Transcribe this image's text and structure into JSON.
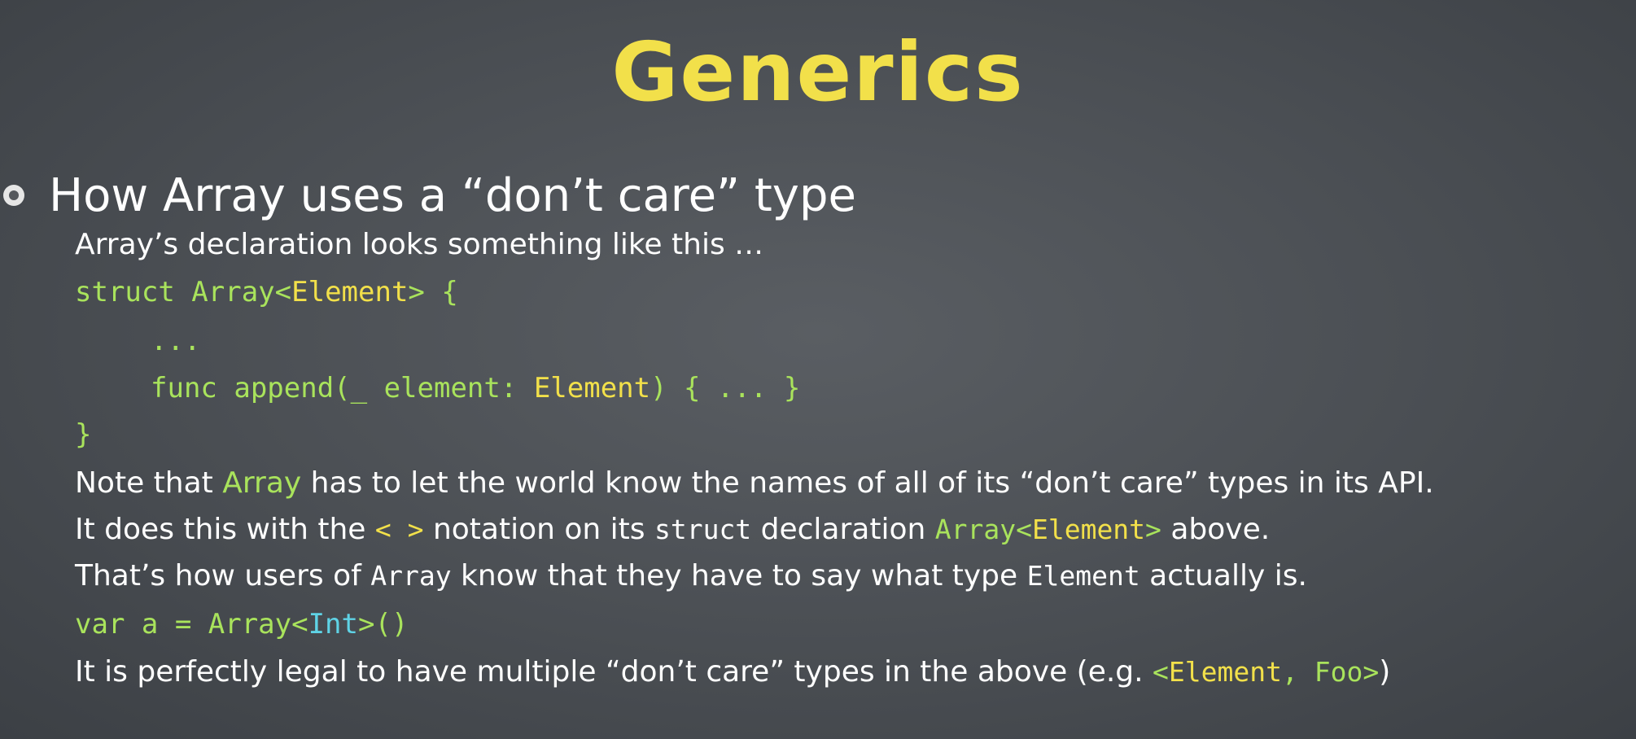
{
  "title": "Generics",
  "bullet": "How Array uses a “don’t care” type",
  "line1": "Array’s declaration looks something like this …",
  "code": {
    "struct_kw": "struct ",
    "array": "Array<",
    "element": "Element",
    "close": "> {",
    "dots": "...",
    "func_prefix": "func append(_ element: ",
    "func_type": "Element",
    "func_suffix": ") { ... }",
    "end_brace": "}"
  },
  "note": {
    "p1": "Note that ",
    "array": "Array",
    "p2": " has to let the world know the names of all of its “don’t care” types in its API."
  },
  "does": {
    "p1": "It does this with the ",
    "brackets": "< >",
    "p2": " notation on its ",
    "struct": "struct",
    "p3": " declaration ",
    "array": "Array<",
    "element": "Element",
    "close": ">",
    "p4": " above."
  },
  "thats": {
    "p1": "That’s how users of ",
    "array": "Array",
    "p2": " know that they have to say what type ",
    "element": "Element",
    "p3": " actually is."
  },
  "var_line": {
    "p1": "var a = Array<",
    "int": "Int",
    "p2": ">()"
  },
  "legal": {
    "p1": "It is perfectly legal to have multiple “don’t care” types in the above (e.g. ",
    "code1": "<",
    "element": "Element",
    "code2": ", Foo>",
    "p2": ")"
  },
  "colors": {
    "title": "#f2e04a",
    "code_green": "#a9e35c",
    "code_yellow": "#f2e04a",
    "code_cyan": "#5fd3e6"
  }
}
